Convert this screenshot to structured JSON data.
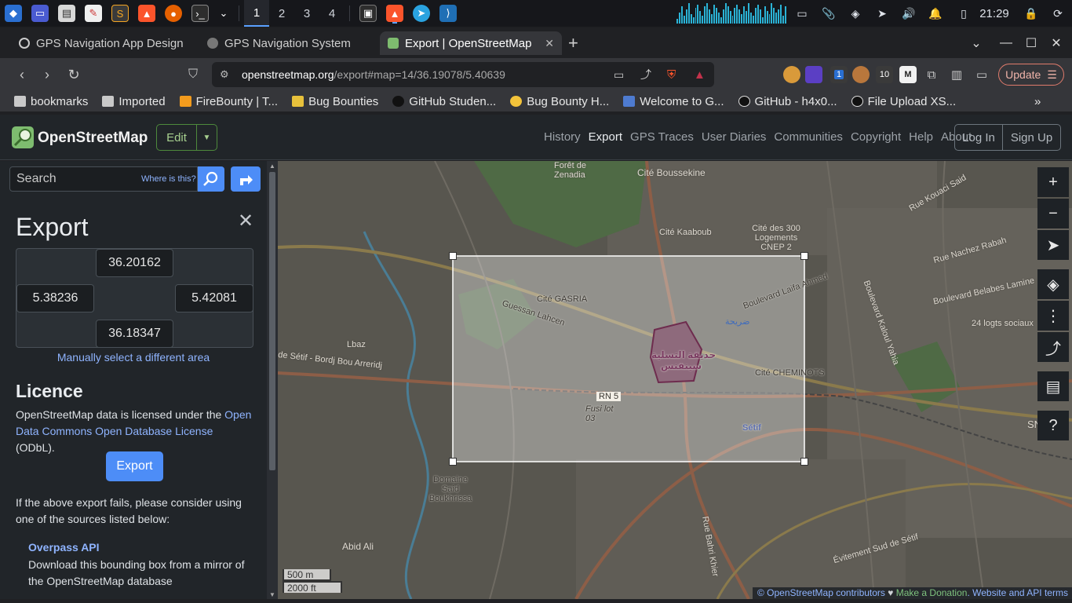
{
  "taskbar": {
    "workspaces": [
      "1",
      "2",
      "3",
      "4"
    ],
    "active_workspace": "1",
    "clock": "21:29",
    "notification_badge": "",
    "accent": "#5aa0ff"
  },
  "browser": {
    "tabs": [
      {
        "label": "GPS Navigation App Design",
        "icon": "openai-icon",
        "active": false
      },
      {
        "label": "GPS Navigation System",
        "icon": "globe-icon",
        "active": false
      },
      {
        "label": "Export | OpenStreetMap",
        "icon": "osm-icon",
        "active": true
      }
    ],
    "new_tab": "+",
    "url_host": "openstreetmap.org",
    "url_path": "/export#map=14/36.19078/5.40639",
    "update_label": "Update",
    "ext_badges": {
      "badge_1": "1",
      "badge_10": "10",
      "m_label": "M"
    }
  },
  "bookmarks": [
    {
      "label": "bookmarks",
      "icon": "folder-icon"
    },
    {
      "label": "Imported",
      "icon": "folder-icon"
    },
    {
      "label": "FireBounty | T...",
      "icon": "firebounty-icon"
    },
    {
      "label": "Bug Bounties",
      "icon": "bug-icon"
    },
    {
      "label": "GitHub Studen...",
      "icon": "github-icon"
    },
    {
      "label": "Bug Bounty H...",
      "icon": "emoji-icon"
    },
    {
      "label": "Welcome to G...",
      "icon": "site-icon"
    },
    {
      "label": "GitHub - h4x0...",
      "icon": "github-icon"
    },
    {
      "label": "File Upload XS...",
      "icon": "circle-icon"
    }
  ],
  "osm": {
    "title": "OpenStreetMap",
    "edit_label": "Edit",
    "nav": [
      "History",
      "Export",
      "GPS Traces",
      "User Diaries",
      "Communities",
      "Copyright",
      "Help",
      "About"
    ],
    "nav_current": "Export",
    "login": "Log In",
    "signup": "Sign Up"
  },
  "sidebar": {
    "search_placeholder": "Search",
    "where_is_this": "Where is this?",
    "heading": "Export",
    "bbox": {
      "north": "36.20162",
      "west": "5.38236",
      "east": "5.42081",
      "south": "36.18347"
    },
    "manual_select": "Manually select a different area",
    "licence_heading": "Licence",
    "licence_text_before": "OpenStreetMap data is licensed under the ",
    "licence_link": "Open Data Commons Open Database License",
    "licence_text_after": " (ODbL).",
    "export_button": "Export",
    "fail_text": "If the above export fails, please consider using one of the sources listed below:",
    "overpass_heading": "Overpass API",
    "overpass_text": "Download this bounding box from a mirror of the OpenStreetMap database"
  },
  "map": {
    "labels": {
      "foret": "Forêt de Zenadia",
      "boussekine": "Cité Boussekine",
      "kaaboub": "Cité Kaaboub",
      "logements": "Cité des 300 Logements CNEP 2",
      "gasria": "Cité GASRIA",
      "guessan": "Guessan Lahcen",
      "boulevard_laifa": "Boulevard Laifa Ahmed",
      "nachez": "Rue Nachez Rabah",
      "belabes": "Boulevard Belabes Lamine",
      "logts": "24 logts sociaux",
      "kaloul": "Boulevard Kaloul Yahia",
      "lbaz": "Lbaz",
      "setif_bordj": "de Sétif - Bordj Bou Arreridj",
      "cheminots": "Cité CHEMINOTS",
      "park_ar": "حديقة التسلية",
      "park_ar2": "سينفنس",
      "rn5": "RN 5",
      "fusil": "Fusi lot 03",
      "setif": "Sétif",
      "domaine": "Domaine Said Boukhrissa",
      "abid": "Abid Ali",
      "bahri": "Rue Bahri Khier",
      "evitement": "Évitement Sud de Sétif",
      "sn": "SN",
      "icon_ar": "ضريحة",
      "kouaci": "Rue Kouaci Said"
    },
    "scale_m": "500 m",
    "scale_ft": "2000 ft",
    "attribution_1": "© OpenStreetMap contributors",
    "attribution_heart": " ♥ ",
    "attribution_2": "Make a Donation",
    "attribution_3": ". Website and API terms"
  }
}
